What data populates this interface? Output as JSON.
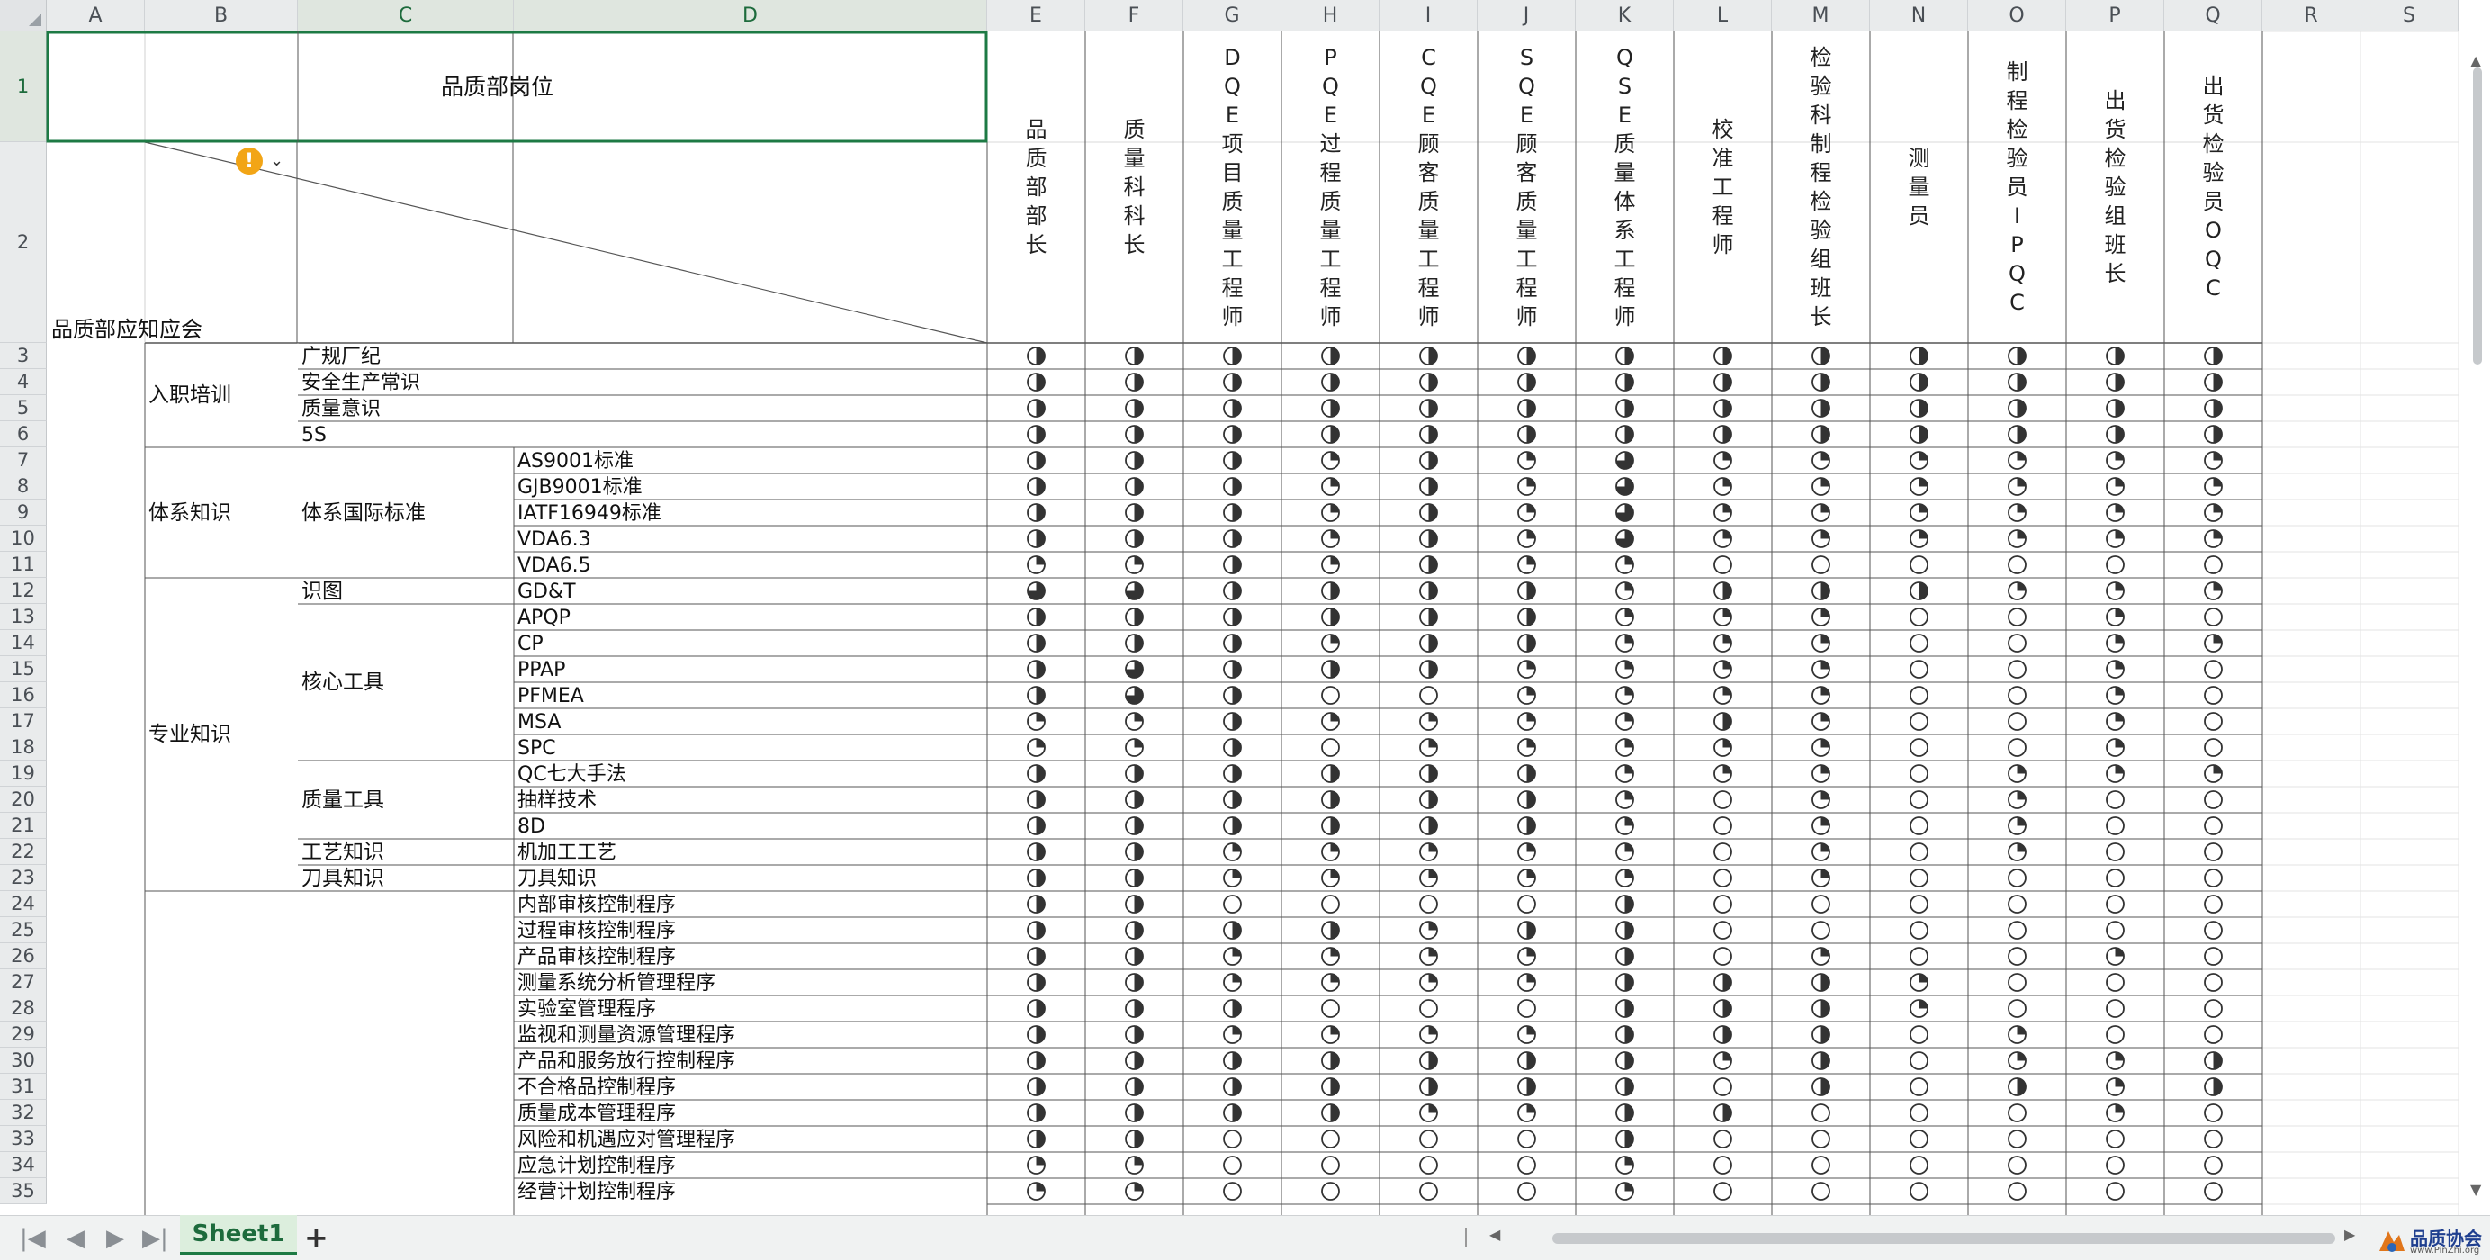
{
  "sheet": {
    "column_headers": [
      "A",
      "B",
      "C",
      "D",
      "E",
      "F",
      "G",
      "H",
      "I",
      "J",
      "K",
      "L",
      "M",
      "N",
      "O",
      "P",
      "Q",
      "R",
      "S"
    ],
    "row_numbers": [
      "1",
      "2",
      "3",
      "4",
      "5",
      "6",
      "7",
      "8",
      "9",
      "10",
      "11",
      "12",
      "13",
      "14",
      "15",
      "16",
      "17",
      "18",
      "19",
      "20",
      "21",
      "22",
      "23",
      "24",
      "25",
      "26",
      "27",
      "28",
      "29",
      "30",
      "31",
      "32",
      "33",
      "34",
      "35"
    ],
    "title": "品质部岗位",
    "corner_label": "品质部应知应会",
    "positions": [
      "品质部部长",
      "质量科科长",
      "DQE项目质量工程师",
      "PQE过程质量工程师",
      "CQE顾客质量工程师",
      "SQE顾客质量工程师",
      "QSE质量体系工程师",
      "校准工程师",
      "检验科制程检验组班长",
      "测量员",
      "制程检验员IPQC",
      "出货检验组班长",
      "出货检验员OQC"
    ],
    "groups": [
      {
        "label": "入职培训"
      },
      {
        "label": "体系知识"
      },
      {
        "label": "专业知识"
      }
    ],
    "subgroups": [
      {
        "label": "体系国际标准"
      },
      {
        "label": "识图"
      },
      {
        "label": "核心工具"
      },
      {
        "label": "质量工具"
      },
      {
        "label": "工艺知识"
      },
      {
        "label": "刀具知识"
      }
    ],
    "items_c": [
      "广规厂纪",
      "安全生产常识",
      "质量意识",
      "5S"
    ],
    "items_d": [
      "AS9001标准",
      "GJB9001标准",
      "IATF16949标准",
      "VDA6.3",
      "VDA6.5",
      "GD&T",
      "APQP",
      "CP",
      "PPAP",
      "PFMEA",
      "MSA",
      "SPC",
      "QC七大手法",
      "抽样技术",
      "8D",
      "机加工工艺",
      "刀具知识",
      "内部审核控制程序",
      "过程审核控制程序",
      "产品审核控制程序",
      "测量系统分析管理程序",
      "实验室管理程序",
      "监视和测量资源管理程序",
      "产品和服务放行控制程序",
      "不合格品控制程序",
      "质量成本管理程序",
      "风险和机遇应对管理程序",
      "应急计划控制程序",
      "经营计划控制程序"
    ],
    "levels_legend": "0=empty circle, 1=quarter, 2=half, 3=three-quarter",
    "matrix": [
      [
        2,
        2,
        2,
        2,
        2,
        2,
        2,
        2,
        2,
        2,
        2,
        2,
        2
      ],
      [
        2,
        2,
        2,
        2,
        2,
        2,
        2,
        2,
        2,
        2,
        2,
        2,
        2
      ],
      [
        2,
        2,
        2,
        2,
        2,
        2,
        2,
        2,
        2,
        2,
        2,
        2,
        2
      ],
      [
        2,
        2,
        2,
        2,
        2,
        2,
        2,
        2,
        2,
        2,
        2,
        2,
        2
      ],
      [
        2,
        2,
        2,
        1,
        2,
        1,
        3,
        1,
        1,
        1,
        1,
        1,
        1
      ],
      [
        2,
        2,
        2,
        1,
        2,
        1,
        3,
        1,
        1,
        1,
        1,
        1,
        1
      ],
      [
        2,
        2,
        2,
        1,
        2,
        1,
        3,
        1,
        1,
        1,
        1,
        1,
        1
      ],
      [
        2,
        2,
        2,
        1,
        2,
        1,
        3,
        1,
        1,
        1,
        1,
        1,
        1
      ],
      [
        1,
        1,
        2,
        1,
        2,
        1,
        1,
        0,
        0,
        0,
        0,
        0,
        0
      ],
      [
        3,
        3,
        2,
        2,
        2,
        2,
        1,
        2,
        2,
        2,
        1,
        1,
        1
      ],
      [
        2,
        2,
        2,
        2,
        2,
        2,
        1,
        1,
        1,
        0,
        0,
        1,
        0
      ],
      [
        2,
        2,
        2,
        1,
        2,
        2,
        1,
        1,
        1,
        0,
        0,
        1,
        1
      ],
      [
        2,
        3,
        2,
        2,
        2,
        1,
        1,
        1,
        1,
        0,
        0,
        1,
        0
      ],
      [
        2,
        3,
        2,
        0,
        0,
        1,
        1,
        1,
        1,
        0,
        0,
        1,
        0
      ],
      [
        1,
        1,
        2,
        1,
        1,
        1,
        1,
        2,
        1,
        0,
        0,
        1,
        0
      ],
      [
        1,
        1,
        2,
        0,
        1,
        1,
        1,
        1,
        1,
        0,
        0,
        1,
        0
      ],
      [
        2,
        2,
        2,
        2,
        2,
        2,
        1,
        1,
        1,
        0,
        1,
        1,
        1
      ],
      [
        2,
        2,
        2,
        2,
        2,
        2,
        1,
        0,
        1,
        0,
        1,
        0,
        0
      ],
      [
        2,
        2,
        2,
        2,
        2,
        2,
        1,
        0,
        1,
        0,
        1,
        0,
        0
      ],
      [
        2,
        2,
        1,
        1,
        1,
        1,
        1,
        0,
        1,
        0,
        1,
        0,
        0
      ],
      [
        2,
        2,
        1,
        1,
        1,
        1,
        1,
        0,
        1,
        0,
        0,
        0,
        0
      ],
      [
        2,
        2,
        0,
        0,
        0,
        0,
        2,
        0,
        0,
        0,
        0,
        0,
        0
      ],
      [
        2,
        2,
        2,
        2,
        1,
        2,
        2,
        0,
        0,
        0,
        0,
        0,
        0
      ],
      [
        2,
        2,
        1,
        1,
        1,
        1,
        2,
        0,
        1,
        0,
        0,
        1,
        0
      ],
      [
        2,
        2,
        1,
        1,
        1,
        1,
        2,
        2,
        2,
        1,
        0,
        0,
        0
      ],
      [
        2,
        2,
        2,
        0,
        0,
        0,
        2,
        2,
        2,
        1,
        0,
        0,
        0
      ],
      [
        2,
        2,
        1,
        1,
        1,
        1,
        2,
        2,
        2,
        0,
        1,
        0,
        0
      ],
      [
        2,
        2,
        2,
        2,
        2,
        2,
        2,
        1,
        2,
        0,
        1,
        1,
        2
      ],
      [
        2,
        2,
        2,
        2,
        2,
        2,
        2,
        0,
        2,
        0,
        2,
        1,
        2
      ],
      [
        2,
        2,
        2,
        2,
        1,
        1,
        2,
        2,
        0,
        0,
        0,
        1,
        0
      ],
      [
        2,
        2,
        0,
        0,
        0,
        0,
        2,
        0,
        0,
        0,
        0,
        0,
        0
      ],
      [
        1,
        1,
        0,
        0,
        0,
        0,
        1,
        0,
        0,
        0,
        0,
        0,
        0
      ],
      [
        1,
        1,
        0,
        0,
        0,
        0,
        1,
        0,
        0,
        0,
        0,
        0,
        0
      ]
    ]
  },
  "tabs": {
    "active": "Sheet1",
    "add_label": "+"
  },
  "nav": {
    "first": "|◀",
    "prev": "◀",
    "next": "▶",
    "last": "▶|"
  },
  "warning": {
    "symbol": "!"
  },
  "logo": {
    "name": "品质协会",
    "url": "www.PinZhi.org"
  },
  "colors": {
    "accent": "#1d7a44",
    "grid": "#d4d4d4",
    "header": "#e9ebec"
  }
}
